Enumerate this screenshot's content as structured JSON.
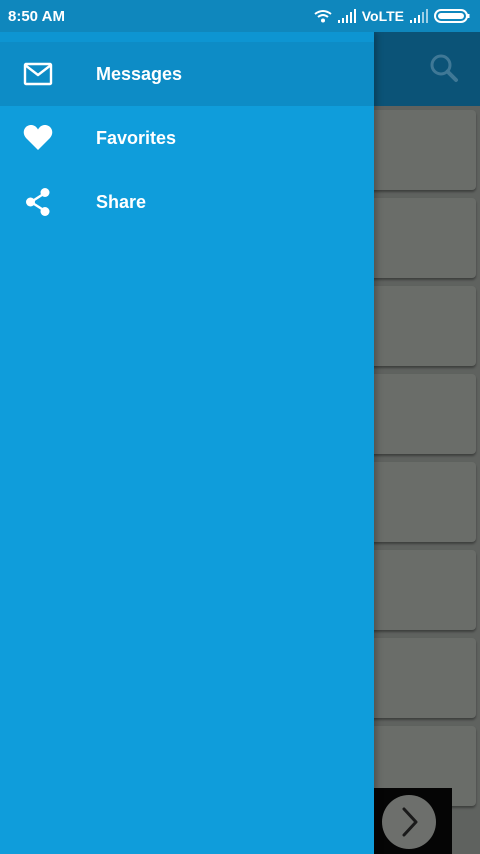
{
  "status_bar": {
    "time": "8:50 AM",
    "network_label": "VoLTE",
    "icons": [
      "wifi-icon",
      "signal-icon",
      "signal-icon",
      "battery-icon"
    ]
  },
  "toolbar": {
    "search_icon": "search-icon"
  },
  "drawer": {
    "items": [
      {
        "label": "Messages",
        "icon": "mail-icon",
        "active": true
      },
      {
        "label": "Favorites",
        "icon": "heart-icon",
        "active": false
      },
      {
        "label": "Share",
        "icon": "share-icon",
        "active": false
      }
    ]
  },
  "bottom": {
    "next_icon": "chevron-right-icon"
  },
  "colors": {
    "drawer_bg": "#0f9ddb",
    "active_item_bg": "#0d8cc6",
    "status_bar": "#0f87bd",
    "toolbar": "#0b5377",
    "card": "#6a6d69"
  }
}
